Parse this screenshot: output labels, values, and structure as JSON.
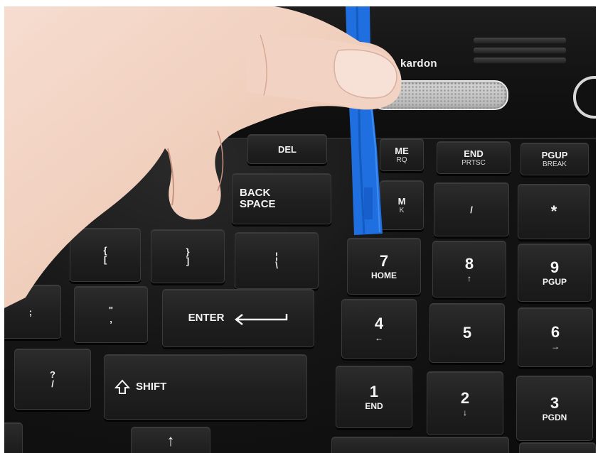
{
  "brand": {
    "text": "kardon"
  },
  "keys": {
    "del": "DEL",
    "backspace_line1": "BACK",
    "backspace_line2": "SPACE",
    "home_partial_top": "ME",
    "home_partial_bottom": "RQ",
    "end_top": "END",
    "end_bottom": "PRTSC",
    "pgup_top": "PGUP",
    "pgup_bottom": "BREAK",
    "numlock_partial_top": "M",
    "numlock_partial_bottom": "K",
    "slash": "/",
    "asterisk": "*",
    "bracket_open_top": "{",
    "bracket_open_bottom": "[",
    "bracket_close_top": "}",
    "bracket_close_bottom": "]",
    "backslash_top": "¦",
    "backslash_bottom": "\\",
    "semicolon": ";",
    "quote_top": "\"",
    "quote_bottom": ",",
    "enter": "ENTER",
    "question_top": "?",
    "question_bottom": "/",
    "shift": "SHIFT",
    "up_arrow": "↑",
    "num7_main": "7",
    "num7_sub": "HOME",
    "num8_main": "8",
    "num8_sub": "↑",
    "num9_main": "9",
    "num9_sub": "PGUP",
    "num4_main": "4",
    "num4_sub": "←",
    "num5_main": "5",
    "num6_main": "6",
    "num6_sub": "→",
    "num1_main": "1",
    "num1_sub": "END",
    "num2_main": "2",
    "num2_sub": "↓",
    "num3_main": "3",
    "num3_sub": "PGDN"
  },
  "colors": {
    "pry_tool": "#1f6fe0",
    "skin": "#f0d2c1",
    "keyboard": "#141414"
  }
}
